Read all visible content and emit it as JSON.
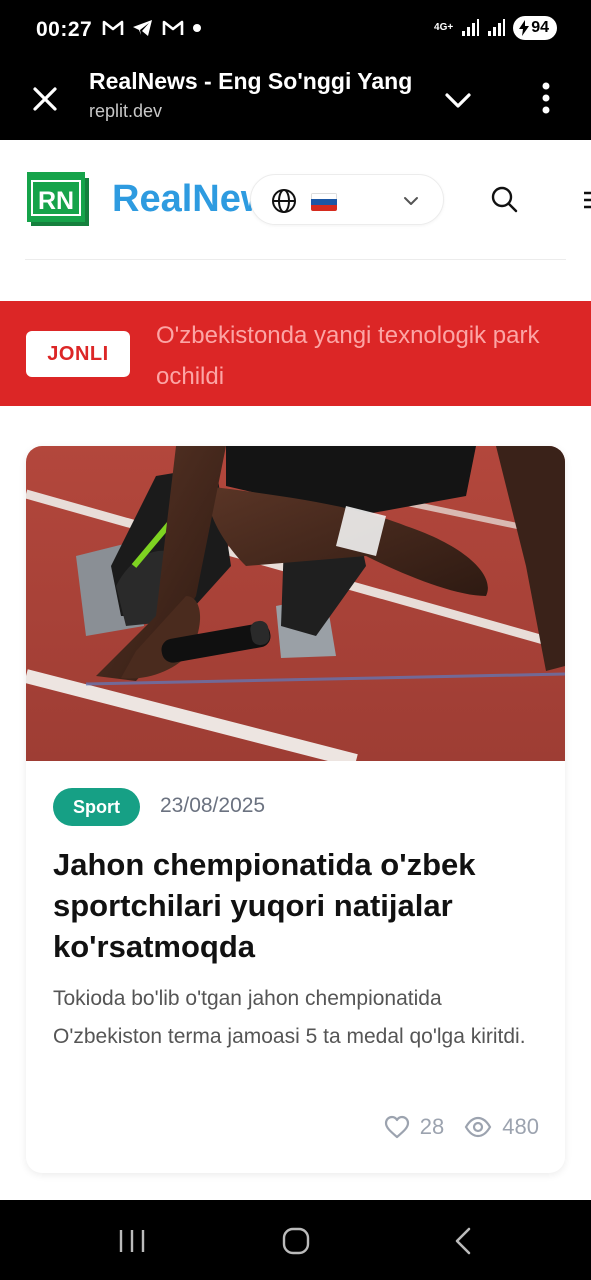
{
  "status_bar": {
    "time": "00:27",
    "network": "4G+",
    "battery": "94"
  },
  "browser": {
    "title": "RealNews - Eng So'nggi Yangiliklar",
    "url": "replit.dev"
  },
  "header": {
    "logo_text": "RN",
    "brand": "RealNews",
    "language": "Russian",
    "colors": {
      "brand": "#2e9be0",
      "logo": "#16a34a"
    }
  },
  "live": {
    "badge": "JONLI",
    "headline": "O'zbekistonda yangi texnologik park ochildi",
    "color": "#dc2626"
  },
  "article": {
    "category": "Sport",
    "date": "23/08/2025",
    "title": "Jahon chempionatida o'zbek sportchilari yuqori natijalar ko'rsatmoqda",
    "excerpt": "Tokioda bo'lib o'tgan jahon chempionatida O'zbekiston terma jamoasi 5 ta medal qo'lga kiritdi.",
    "likes": "28",
    "views": "480",
    "category_color": "#16a085"
  }
}
